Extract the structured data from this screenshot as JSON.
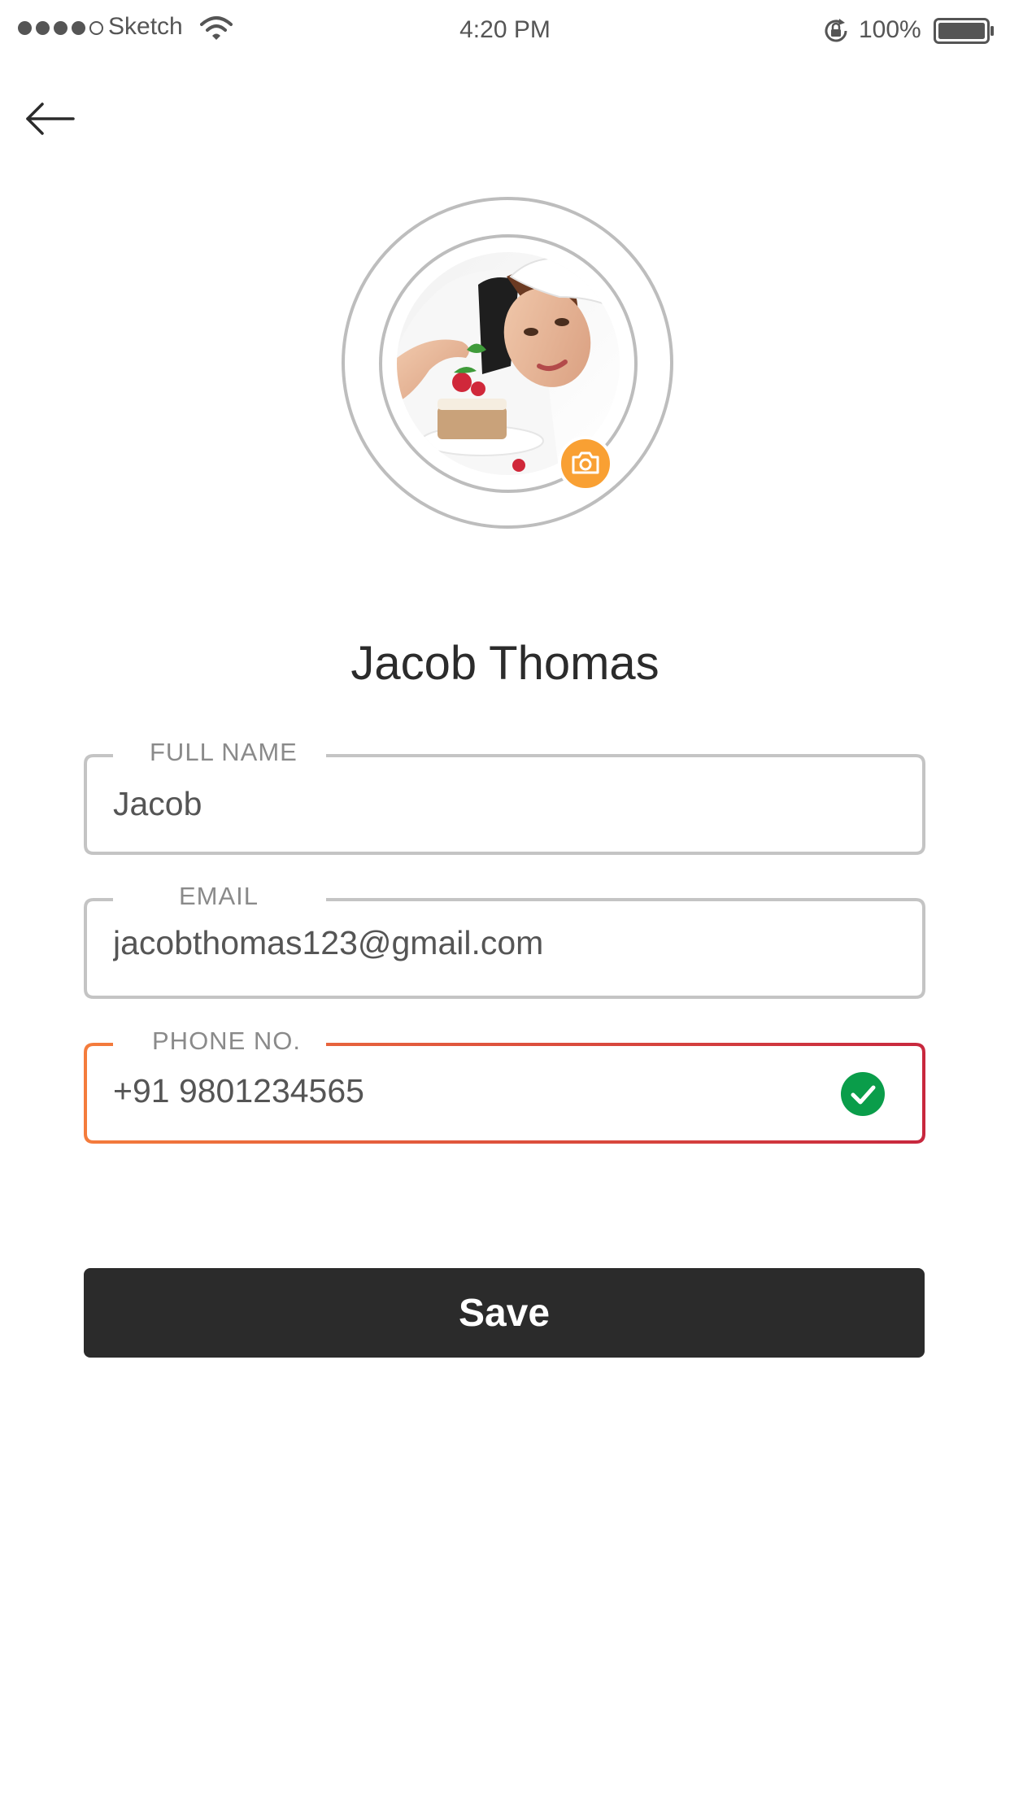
{
  "status_bar": {
    "carrier": "Sketch",
    "time": "4:20 PM",
    "battery": "100%",
    "signal_icon": "signal-dots-icon",
    "wifi_icon": "wifi-icon",
    "lock_icon": "rotation-lock-icon",
    "battery_icon": "battery-icon"
  },
  "header": {
    "back_icon": "arrow-left-icon"
  },
  "profile": {
    "photo": "chef-avatar-photo",
    "camera_icon": "camera-icon",
    "camera_color": "#f9a033",
    "display_name": "Jacob Thomas"
  },
  "form": {
    "full_name": {
      "label": "FULL NAME",
      "value": "Jacob"
    },
    "email": {
      "label": "EMAIL",
      "value": "jacobthomas123@gmail.com"
    },
    "phone": {
      "label": "PHONE NO.",
      "value": "+91 9801234565",
      "status_icon": "check-circle-icon",
      "status_color": "#0a9d4a"
    }
  },
  "actions": {
    "save_label": "Save"
  },
  "colors": {
    "accent_gradient_start": "#f47c3c",
    "accent_gradient_end": "#c8283e",
    "button_bg": "#2b2b2b",
    "field_border": "#c4c4c4"
  }
}
